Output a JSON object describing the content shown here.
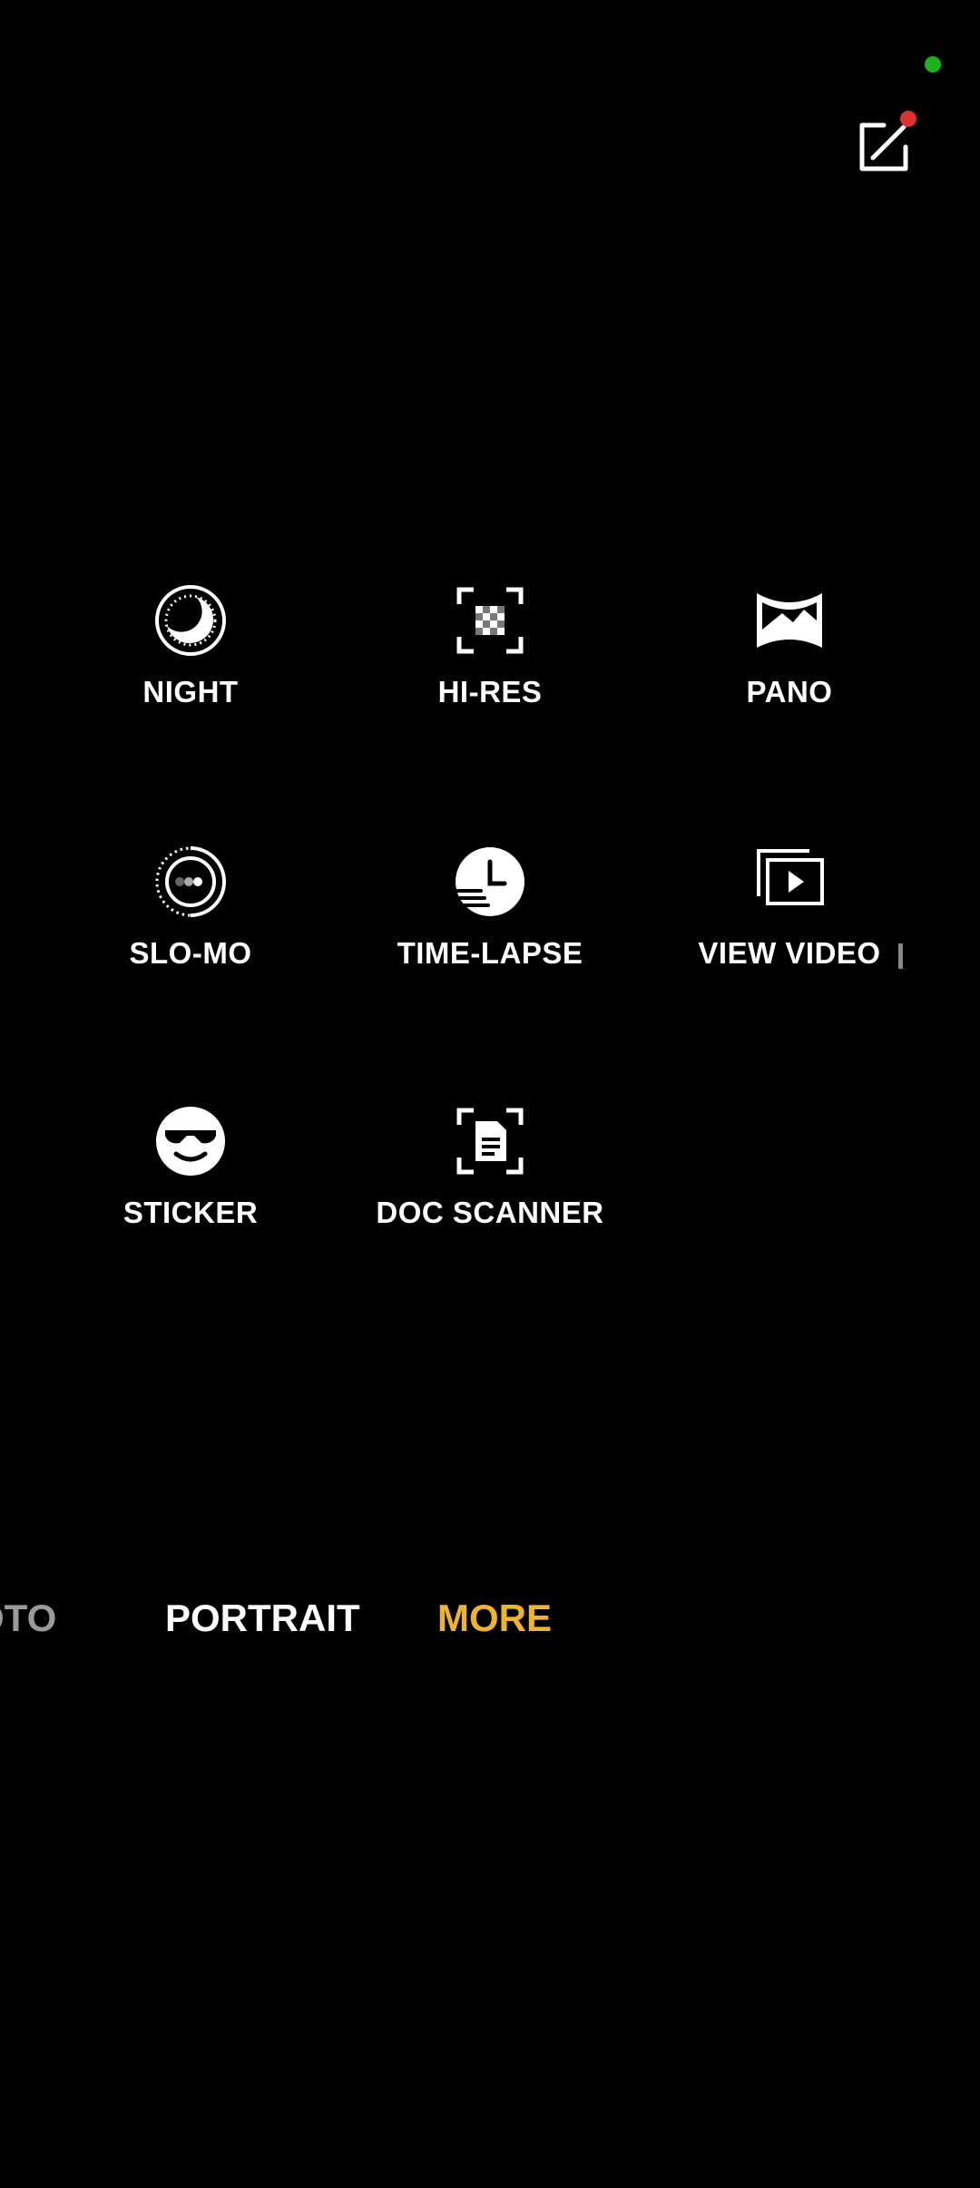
{
  "status": {
    "privacy_indicator_color": "#1bb31b"
  },
  "toolbar": {
    "edit_icon": "edit-external-icon",
    "badge_color": "#e03131"
  },
  "modes": [
    {
      "label": "NIGHT",
      "icon": "moon-icon"
    },
    {
      "label": "HI-RES",
      "icon": "hi-res-icon"
    },
    {
      "label": "PANO",
      "icon": "panorama-icon"
    },
    {
      "label": "SLO-MO",
      "icon": "slow-motion-icon"
    },
    {
      "label": "TIME-LAPSE",
      "icon": "time-lapse-icon"
    },
    {
      "label": "VIEW VIDEO",
      "icon": "multi-view-video-icon"
    },
    {
      "label": "STICKER",
      "icon": "sticker-icon"
    },
    {
      "label": "DOC SCANNER",
      "icon": "doc-scanner-icon"
    }
  ],
  "mode_bar": {
    "tabs": [
      {
        "label": "OTO"
      },
      {
        "label": "PORTRAIT"
      },
      {
        "label": "MORE"
      }
    ],
    "active_color": "#f0b429",
    "inactive_color": "#9a9a9a"
  }
}
